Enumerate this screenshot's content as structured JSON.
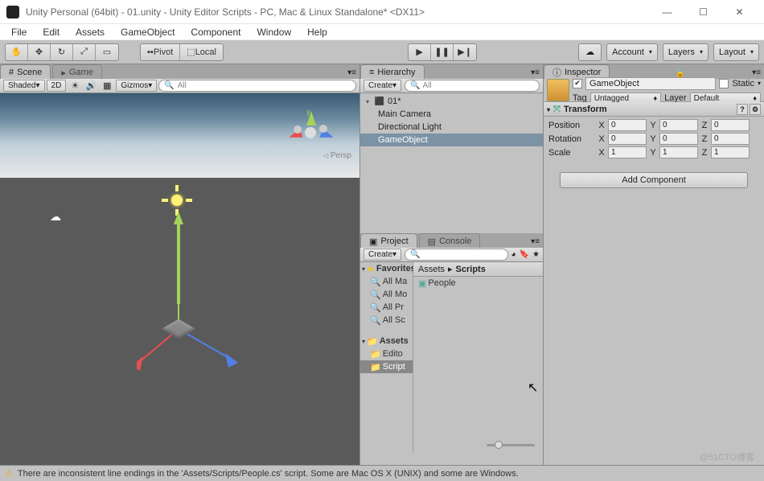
{
  "window": {
    "title": "Unity Personal (64bit) - 01.unity - Unity Editor Scripts - PC, Mac & Linux Standalone* <DX11>"
  },
  "menu": [
    "File",
    "Edit",
    "Assets",
    "GameObject",
    "Component",
    "Window",
    "Help"
  ],
  "toolbar": {
    "pivot": "Pivot",
    "local": "Local",
    "account": "Account",
    "layers": "Layers",
    "layout": "Layout"
  },
  "scene": {
    "tab_scene": "Scene",
    "tab_game": "Game",
    "shaded": "Shaded",
    "mode2d": "2D",
    "gizmos": "Gizmos",
    "search_ph": "All",
    "persp": "Persp"
  },
  "hierarchy": {
    "title": "Hierarchy",
    "create": "Create",
    "search_ph": "All",
    "root": "01*",
    "items": [
      "Main Camera",
      "Directional Light",
      "GameObject"
    ]
  },
  "project": {
    "title": "Project",
    "console": "Console",
    "create": "Create",
    "favorites": "Favorites",
    "fav_items": [
      "All Ma",
      "All Mo",
      "All Pr",
      "All Sc"
    ],
    "assets": "Assets",
    "asset_items": [
      "Edito",
      "Script"
    ],
    "breadcrumb": [
      "Assets",
      "Scripts"
    ],
    "people": "People"
  },
  "inspector": {
    "title": "Inspector",
    "name": "GameObject",
    "static": "Static",
    "tag_label": "Tag",
    "tag_value": "Untagged",
    "layer_label": "Layer",
    "layer_value": "Default",
    "transform": "Transform",
    "position": "Position",
    "rotation": "Rotation",
    "scale": "Scale",
    "px": "0",
    "py": "0",
    "pz": "0",
    "rx": "0",
    "ry": "0",
    "rz": "0",
    "sx": "1",
    "sy": "1",
    "sz": "1",
    "add_component": "Add Component"
  },
  "status": "There are inconsistent line endings in the 'Assets/Scripts/People.cs' script. Some are Mac OS X (UNIX) and some are Windows.",
  "watermark": "@51CTO博客"
}
